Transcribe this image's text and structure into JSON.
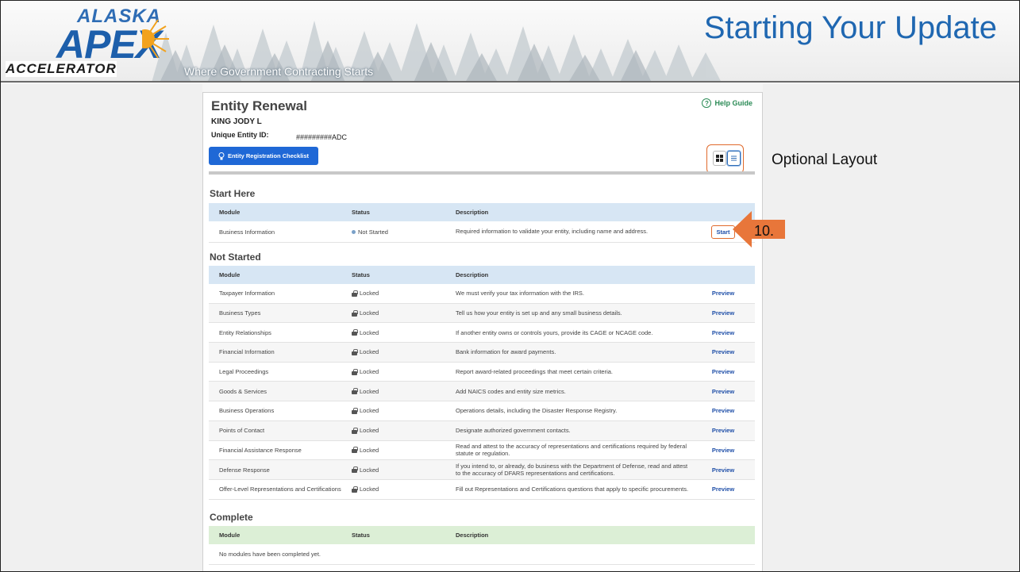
{
  "slide": {
    "title": "Starting Your Update",
    "tagline": "Where Government Contracting Starts",
    "logo": {
      "line1": "ALASKA",
      "line2": "APEX",
      "line3": "ACCELERATOR"
    },
    "annotation_optional_layout": "Optional Layout",
    "annotation_step": "10."
  },
  "colors": {
    "accent_orange": "#e06a2c",
    "title_blue": "#1f67b1",
    "button_blue": "#1f68d6",
    "help_green": "#2a8a55"
  },
  "entity": {
    "title": "Entity Renewal",
    "name": "KING JODY L",
    "uei_label": "Unique Entity ID:",
    "uei_value": "#########ADC",
    "help_guide": "Help Guide",
    "help_icon": "question-circle-icon",
    "checklist_button": "Entity Registration Checklist",
    "checklist_icon": "lightbulb-icon"
  },
  "columns": {
    "module": "Module",
    "status": "Status",
    "description": "Description"
  },
  "start_here": {
    "title": "Start Here",
    "rows": [
      {
        "module": "Business Information",
        "status": "Not Started",
        "description": "Required information to validate your entity, including name and address.",
        "action": "Start"
      }
    ]
  },
  "not_started": {
    "title": "Not Started",
    "rows": [
      {
        "module": "Taxpayer Information",
        "status": "Locked",
        "description": "We must verify your tax information with the IRS.",
        "action": "Preview"
      },
      {
        "module": "Business Types",
        "status": "Locked",
        "description": "Tell us how your entity is set up and any small business details.",
        "action": "Preview"
      },
      {
        "module": "Entity Relationships",
        "status": "Locked",
        "description": "If another entity owns or controls yours, provide its CAGE or NCAGE code.",
        "action": "Preview"
      },
      {
        "module": "Financial Information",
        "status": "Locked",
        "description": "Bank information for award payments.",
        "action": "Preview"
      },
      {
        "module": "Legal Proceedings",
        "status": "Locked",
        "description": "Report award-related proceedings that meet certain criteria.",
        "action": "Preview"
      },
      {
        "module": "Goods & Services",
        "status": "Locked",
        "description": "Add NAICS codes and entity size metrics.",
        "action": "Preview"
      },
      {
        "module": "Business Operations",
        "status": "Locked",
        "description": "Operations details, including the Disaster Response Registry.",
        "action": "Preview"
      },
      {
        "module": "Points of Contact",
        "status": "Locked",
        "description": "Designate authorized government contacts.",
        "action": "Preview"
      },
      {
        "module": "Financial Assistance Response",
        "status": "Locked",
        "description": "Read and attest to the accuracy of representations and certifications required by federal statute or regulation.",
        "action": "Preview"
      },
      {
        "module": "Defense Response",
        "status": "Locked",
        "description": "If you intend to, or already, do business with the Department of Defense, read and attest to the accuracy of DFARS representations and certifications.",
        "action": "Preview"
      },
      {
        "module": "Offer-Level Representations and Certifications",
        "status": "Locked",
        "description": "Fill out Representations and Certifications questions that apply to specific procurements.",
        "action": "Preview"
      }
    ]
  },
  "complete": {
    "title": "Complete",
    "empty_message": "No modules have been completed yet."
  }
}
